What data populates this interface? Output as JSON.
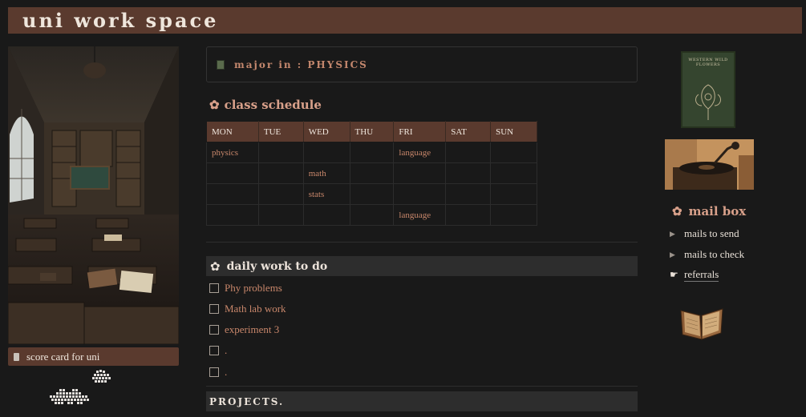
{
  "page": {
    "title": "uni work space"
  },
  "left": {
    "scorecard_label": "score card for uni"
  },
  "major": {
    "text": "major in : PHYSICS"
  },
  "schedule": {
    "title": "class schedule",
    "days": [
      "MON",
      "TUE",
      "WED",
      "THU",
      "FRI",
      "SAT",
      "SUN"
    ],
    "rows": [
      [
        "physics",
        "",
        "",
        "",
        "language",
        "",
        ""
      ],
      [
        "",
        "",
        "math",
        "",
        "",
        "",
        ""
      ],
      [
        "",
        "",
        "stats",
        "",
        "",
        "",
        ""
      ],
      [
        "",
        "",
        "",
        "",
        "language",
        "",
        ""
      ]
    ]
  },
  "daily": {
    "title": "daily work to do",
    "items": [
      "Phy problems",
      "Math lab work",
      "experiment 3",
      ".",
      "."
    ]
  },
  "projects": {
    "title": "PROJECTS."
  },
  "mailbox": {
    "title": "mail box",
    "items": [
      "mails to send",
      "mails to check",
      "referrals"
    ]
  },
  "book_cover": {
    "text": "WESTERN WILD FLOWERS"
  },
  "colors": {
    "accent_brown": "#5a3a2e",
    "text_rust": "#c9876b",
    "heading_pink": "#d8a08a",
    "background": "#191919"
  }
}
